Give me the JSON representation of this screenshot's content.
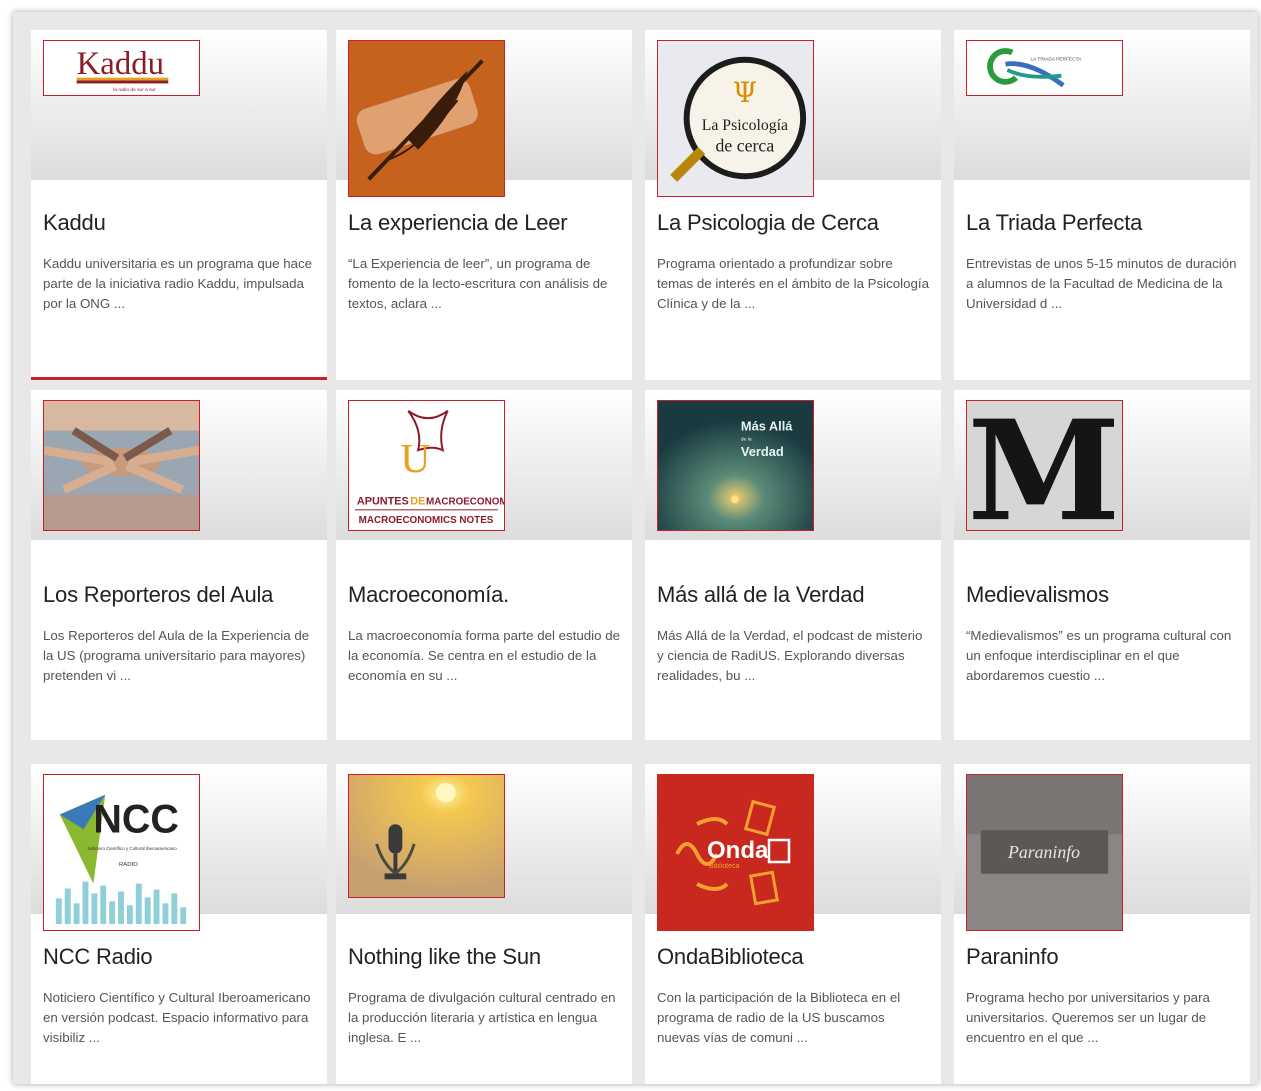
{
  "programs": [
    {
      "title": "Kaddu",
      "description": "Kaddu universitaria es un programa que hace parte de la iniciativa radio Kaddu, impulsada por la ONG ...",
      "image_label": "Kaddu",
      "image_sublabel": "la radio de sur a sur"
    },
    {
      "title": "La experiencia de Leer",
      "description": "“La Experiencia de leer”, un programa de fomento de la lecto-escritura con análisis de textos, aclara ..."
    },
    {
      "title": "La Psicologia de Cerca",
      "description": "Programa orientado a profundizar sobre temas de interés en el ámbito de la Psicología Clínica y de la ...",
      "image_label_1": "La Psicología",
      "image_label_2": "de cerca",
      "image_symbol": "Ψ"
    },
    {
      "title": "La Triada Perfecta",
      "description": "Entrevistas de unos 5-15 minutos de duración a alumnos de la Facultad de Medicina de la Universidad d ...",
      "image_label": "LA TRIADA PERFECTA"
    },
    {
      "title": "Los Reporteros del Aula",
      "description": "Los Reporteros del Aula de la Experiencia de la US (programa universitario para mayores) pretenden vi ..."
    },
    {
      "title": "Macroeconomía.",
      "description": "La macroeconomía forma parte del estudio de la economía. Se centra en el estudio de la economía en su ...",
      "image_label_1": "APUNTES",
      "image_label_amp": "DE",
      "image_label_2": "MACROECONOMÍA",
      "image_label_3": "MACROECONOMICS NOTES"
    },
    {
      "title": "Más allá de la Verdad",
      "description": "Más Allá de la Verdad, el podcast de misterio y ciencia de RadiUS. Explorando diversas realidades, bu ...",
      "image_label_1": "Más Allá",
      "image_label_2": "de la",
      "image_label_3": "Verdad"
    },
    {
      "title": "Medievalismos",
      "description": "“Medievalismos” es un programa cultural con un enfoque interdisciplinar en el que abordaremos cuestio ...",
      "image_label": "M"
    },
    {
      "title": "NCC Radio",
      "description": "Noticiero Científico y Cultural Iberoamericano en versión podcast. Espacio informativo para visibiliz ...",
      "image_label": "NCC",
      "image_sublabel": "Noticiero Científico y Cultural Iberoamericano",
      "image_radio": "RADIO"
    },
    {
      "title": "Nothing like the Sun",
      "description": "Programa de divulgación cultural centrado en la producción literaria y artística en lengua inglesa. E ..."
    },
    {
      "title": "OndaBiblioteca",
      "description": "Con la participación de la Biblioteca en el programa de radio de la US buscamos nuevas vías de comuni ...",
      "image_label": "Onda",
      "image_sublabel": "Biblioteca"
    },
    {
      "title": "Paraninfo",
      "description": "Programa hecho por universitarios y para universitarios. Queremos ser un lugar de encuentro en el que ...",
      "image_label": "Paraninfo"
    }
  ],
  "colors": {
    "accent": "#c8202a",
    "background": "#e9e7e7"
  }
}
